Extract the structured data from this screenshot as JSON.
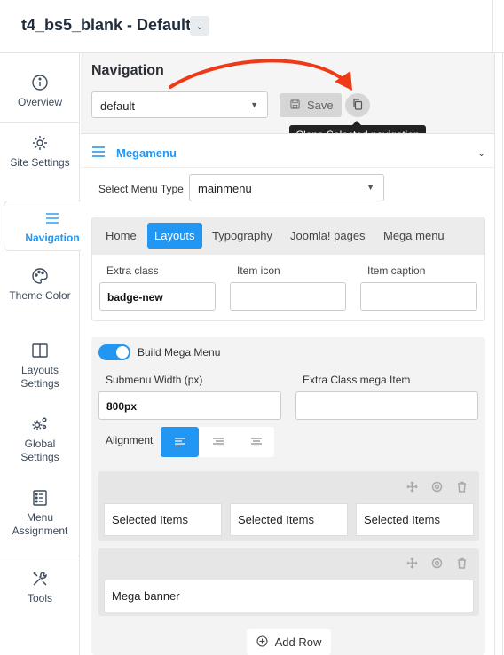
{
  "header": {
    "title": "t4_bs5_blank - Default",
    "dropdown_icon": "chevron-down-icon"
  },
  "sidebar": {
    "items": [
      {
        "label": "Overview",
        "icon": "info-icon"
      },
      {
        "label": "Site Settings",
        "icon": "gear-icon"
      },
      {
        "label": "Navigation",
        "icon": "menu-icon",
        "active": true
      },
      {
        "label": "Theme Color",
        "icon": "palette-icon"
      },
      {
        "label": "Layouts Settings",
        "icon": "layout-icon"
      },
      {
        "label": "Global Settings",
        "icon": "gears-icon"
      },
      {
        "label": "Menu Assignment",
        "icon": "list-icon"
      },
      {
        "label": "Tools",
        "icon": "tools-icon"
      }
    ]
  },
  "navigation": {
    "title": "Navigation",
    "selected_nav": "default",
    "save_label": "Save",
    "clone_tooltip": "Clone Selected navigation"
  },
  "megamenu": {
    "title": "Megamenu",
    "menu_type_label": "Select Menu Type",
    "menu_type_value": "mainmenu",
    "tabs": [
      "Home",
      "Layouts",
      "Typography",
      "Joomla! pages",
      "Mega menu"
    ],
    "active_tab": "Layouts",
    "fields": {
      "extra_class_label": "Extra class",
      "extra_class_value": "badge-new",
      "item_icon_label": "Item icon",
      "item_icon_value": "",
      "item_caption_label": "Item caption",
      "item_caption_value": ""
    },
    "build": {
      "toggle_label": "Build Mega Menu",
      "toggle_on": true,
      "submenu_width_label": "Submenu Width (px)",
      "submenu_width_value": "800px",
      "extra_class_mega_label": "Extra Class mega Item",
      "extra_class_mega_value": "",
      "alignment_label": "Alignment",
      "alignment_selected": "left",
      "rows": [
        {
          "columns": [
            "Selected Items",
            "Selected Items",
            "Selected Items"
          ]
        },
        {
          "columns": [
            "Mega banner"
          ]
        }
      ],
      "add_row_label": "Add Row"
    }
  },
  "colors": {
    "accent": "#2196f3",
    "annotation_arrow": "#f03a17"
  }
}
